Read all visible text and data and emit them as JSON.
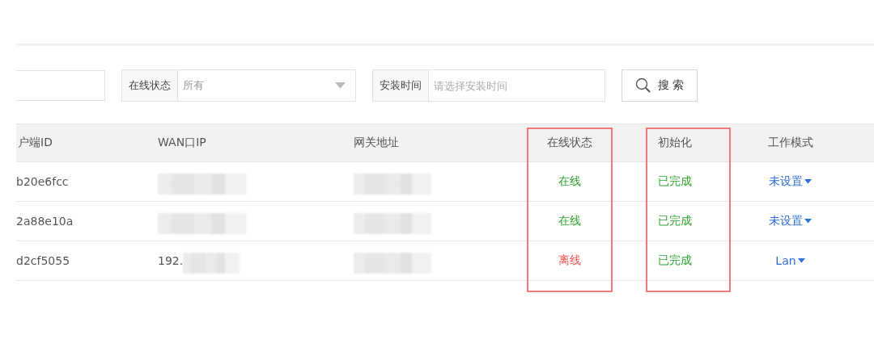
{
  "filters": [
    {
      "kind": "text"
    },
    {
      "kind": "select",
      "label": "在线状态",
      "value": "所有"
    },
    {
      "kind": "date",
      "label": "安装时间",
      "placeholder": "请选择安装时间"
    }
  ],
  "search_button": "搜 索",
  "table": {
    "columns": [
      {
        "label": "户端ID",
        "highlighted": false
      },
      {
        "label": "WAN口IP",
        "highlighted": false
      },
      {
        "label": "网关地址",
        "highlighted": false
      },
      {
        "label": "在线状态",
        "highlighted": true
      },
      {
        "label": "初始化",
        "highlighted": true
      },
      {
        "label": "工作模式",
        "highlighted": false
      }
    ],
    "rows": [
      {
        "id": "b20e6fcc",
        "wan_ip_redacted": true,
        "gateway_redacted": true,
        "status": "在线",
        "online": true,
        "init": "已完成",
        "init_done": true,
        "mode": "未设置"
      },
      {
        "id": "2a88e10a",
        "wan_ip_redacted": true,
        "gateway_redacted": true,
        "status": "在线",
        "online": true,
        "init": "已完成",
        "init_done": true,
        "mode": "未设置"
      },
      {
        "id": "d2cf5055",
        "wan_ip": "192.",
        "wan_ip_redacted": true,
        "gateway_redacted": true,
        "status": "离线",
        "online": false,
        "init": "已完成",
        "init_done": true,
        "mode": "Lan"
      }
    ]
  }
}
